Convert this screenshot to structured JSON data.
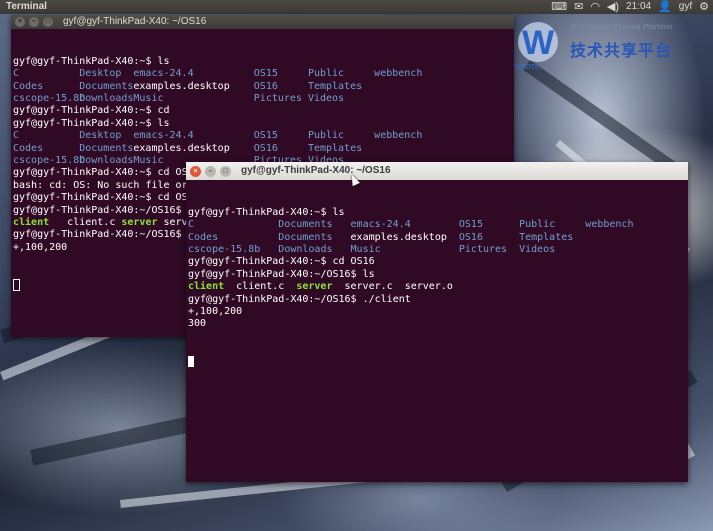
{
  "top_panel": {
    "app_title": "Terminal",
    "clock": "21:04",
    "user": "gyf",
    "icons": [
      "keyboard-icon",
      "mail-icon",
      "wifi-icon",
      "volume-icon",
      "user-icon",
      "gear-icon"
    ]
  },
  "watermark": {
    "logo_letter": "W",
    "english": "Technology Sharing Platform",
    "chinese": "技术共享平台",
    "sub": "WEOTE"
  },
  "back_window": {
    "title": "gyf@gyf-ThinkPad-X40: ~/OS16",
    "lines": [
      [
        {
          "t": "gyf@gyf-ThinkPad-X40:~$ ls"
        }
      ],
      [
        {
          "t": "C",
          "k": "dir",
          "w": 11
        },
        {
          "t": "Desktop",
          "k": "dir",
          "w": 9
        },
        {
          "t": "emacs-24.4",
          "k": "dir",
          "w": 20
        },
        {
          "t": "OS15",
          "k": "dir",
          "w": 9
        },
        {
          "t": "Public",
          "k": "dir",
          "w": 11
        },
        {
          "t": "webbench",
          "k": "dir"
        }
      ],
      [
        {
          "t": "Codes",
          "k": "dir",
          "w": 11
        },
        {
          "t": "Documents",
          "k": "dir",
          "w": 9
        },
        {
          "t": "examples.desktop",
          "w": 20
        },
        {
          "t": "OS16",
          "k": "dir",
          "w": 9
        },
        {
          "t": "Templates",
          "k": "dir",
          "w": 11
        }
      ],
      [
        {
          "t": "cscope-15.8b",
          "k": "dir",
          "w": 11
        },
        {
          "t": "Downloads",
          "k": "dir",
          "w": 9
        },
        {
          "t": "Music",
          "k": "dir",
          "w": 20
        },
        {
          "t": "Pictures",
          "k": "dir",
          "w": 9
        },
        {
          "t": "Videos",
          "k": "dir",
          "w": 11
        }
      ],
      [
        {
          "t": "gyf@gyf-ThinkPad-X40:~$ cd"
        }
      ],
      [
        {
          "t": "gyf@gyf-ThinkPad-X40:~$ ls"
        }
      ],
      [
        {
          "t": "C",
          "k": "dir",
          "w": 11
        },
        {
          "t": "Desktop",
          "k": "dir",
          "w": 9
        },
        {
          "t": "emacs-24.4",
          "k": "dir",
          "w": 20
        },
        {
          "t": "OS15",
          "k": "dir",
          "w": 9
        },
        {
          "t": "Public",
          "k": "dir",
          "w": 11
        },
        {
          "t": "webbench",
          "k": "dir"
        }
      ],
      [
        {
          "t": "Codes",
          "k": "dir",
          "w": 11
        },
        {
          "t": "Documents",
          "k": "dir",
          "w": 9
        },
        {
          "t": "examples.desktop",
          "w": 20
        },
        {
          "t": "OS16",
          "k": "dir",
          "w": 9
        },
        {
          "t": "Templates",
          "k": "dir",
          "w": 11
        }
      ],
      [
        {
          "t": "cscope-15.8b",
          "k": "dir",
          "w": 11
        },
        {
          "t": "Downloads",
          "k": "dir",
          "w": 9
        },
        {
          "t": "Music",
          "k": "dir",
          "w": 20
        },
        {
          "t": "Pictures",
          "k": "dir",
          "w": 9
        },
        {
          "t": "Videos",
          "k": "dir",
          "w": 11
        }
      ],
      [
        {
          "t": "gyf@gyf-ThinkPad-X40:~$ cd OS"
        }
      ],
      [
        {
          "t": "bash: cd: OS: No such file or directory"
        }
      ],
      [
        {
          "t": "gyf@gyf-ThinkPad-X40:~$ cd OS16"
        }
      ],
      [
        {
          "t": "gyf@gyf-ThinkPad-X40:~/OS16$ ls"
        }
      ],
      [
        {
          "t": "client",
          "k": "exe",
          "w": 9
        },
        {
          "t": "client.c",
          "w": 9
        },
        {
          "t": "server",
          "k": "exe",
          "w": 7
        },
        {
          "t": "server.c",
          "w": 10
        },
        {
          "t": "server.o"
        }
      ],
      [
        {
          "t": "gyf@gyf-ThinkPad-X40:~/OS16$ ./server"
        }
      ],
      [
        {
          "t": "+,100,200"
        }
      ]
    ]
  },
  "front_window": {
    "title": "gyf@gyf-ThinkPad-X40: ~/OS16",
    "lines": [
      [
        {
          "t": "gyf@gyf-ThinkPad-X40:~$ ls"
        }
      ],
      [
        {
          "t": "C",
          "k": "dir",
          "w": 15
        },
        {
          "t": "Documents",
          "k": "dir",
          "w": 12
        },
        {
          "t": "emacs-24.4",
          "k": "dir",
          "w": 18
        },
        {
          "t": "OS15",
          "k": "dir",
          "w": 10
        },
        {
          "t": "Public",
          "k": "dir",
          "w": 11
        },
        {
          "t": "webbench",
          "k": "dir"
        }
      ],
      [
        {
          "t": "Codes",
          "k": "dir",
          "w": 15
        },
        {
          "t": "Documents",
          "k": "dir",
          "w": 12
        },
        {
          "t": "examples.desktop",
          "w": 18
        },
        {
          "t": "OS16",
          "k": "dir",
          "w": 10
        },
        {
          "t": "Templates",
          "k": "dir",
          "w": 11
        }
      ],
      [
        {
          "t": "cscope-15.8b",
          "k": "dir",
          "w": 15
        },
        {
          "t": "Downloads",
          "k": "dir",
          "w": 12
        },
        {
          "t": "Music",
          "k": "dir",
          "w": 18
        },
        {
          "t": "Pictures",
          "k": "dir",
          "w": 10
        },
        {
          "t": "Videos",
          "k": "dir",
          "w": 11
        }
      ],
      [
        {
          "t": "gyf@gyf-ThinkPad-X40:~$ cd OS16"
        }
      ],
      [
        {
          "t": "gyf@gyf-ThinkPad-X40:~/OS16$ ls"
        }
      ],
      [
        {
          "t": "client",
          "k": "exe",
          "w": 8
        },
        {
          "t": "client.c",
          "w": 10
        },
        {
          "t": "server",
          "k": "exe",
          "w": 8
        },
        {
          "t": "server.c",
          "w": 10
        },
        {
          "t": "server.o"
        }
      ],
      [
        {
          "t": "gyf@gyf-ThinkPad-X40:~/OS16$ ./client"
        }
      ],
      [
        {
          "t": "+,100,200"
        }
      ],
      [
        {
          "t": "300"
        }
      ]
    ]
  },
  "colors": {
    "terminal_bg": "#300a24",
    "directory": "#729fcf",
    "executable": "#8ae234",
    "close_button": "#e0573b"
  }
}
